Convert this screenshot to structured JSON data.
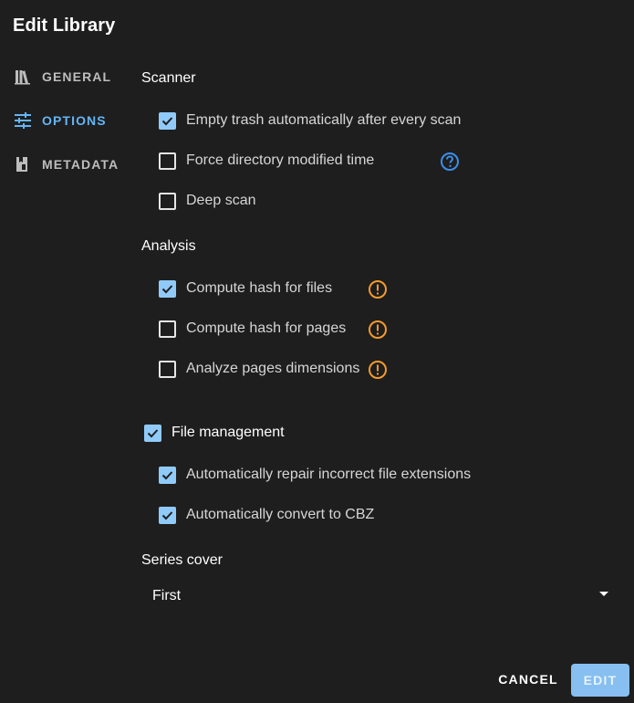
{
  "dialog": {
    "title": "Edit Library"
  },
  "nav": {
    "items": [
      {
        "label": "GENERAL",
        "icon": "books-icon",
        "active": false
      },
      {
        "label": "OPTIONS",
        "icon": "tune-icon",
        "active": true
      },
      {
        "label": "METADATA",
        "icon": "book-tag-icon",
        "active": false
      }
    ]
  },
  "scanner": {
    "title": "Scanner",
    "options": [
      {
        "label": "Empty trash automatically after every scan",
        "checked": true
      },
      {
        "label": "Force directory modified time",
        "checked": false,
        "icon": "help-circle-icon"
      },
      {
        "label": "Deep scan",
        "checked": false
      }
    ]
  },
  "analysis": {
    "title": "Analysis",
    "options": [
      {
        "label": "Compute hash for files",
        "checked": true,
        "icon": "alert-circle-icon"
      },
      {
        "label": "Compute hash for pages",
        "checked": false,
        "icon": "alert-circle-icon"
      },
      {
        "label": "Analyze pages dimensions",
        "checked": false,
        "icon": "alert-circle-icon"
      }
    ]
  },
  "file_management": {
    "label": "File management",
    "checked": true,
    "options": [
      {
        "label": "Automatically repair incorrect file extensions",
        "checked": true
      },
      {
        "label": "Automatically convert to CBZ",
        "checked": true
      }
    ]
  },
  "series_cover": {
    "title": "Series cover",
    "value": "First"
  },
  "actions": {
    "cancel": "CANCEL",
    "edit": "EDIT"
  },
  "colors": {
    "background": "#1e1e1e",
    "accent": "#64b5f6",
    "checkbox_checked": "#90caf9",
    "warning": "#f59a2c",
    "help": "#3d8ee6"
  }
}
